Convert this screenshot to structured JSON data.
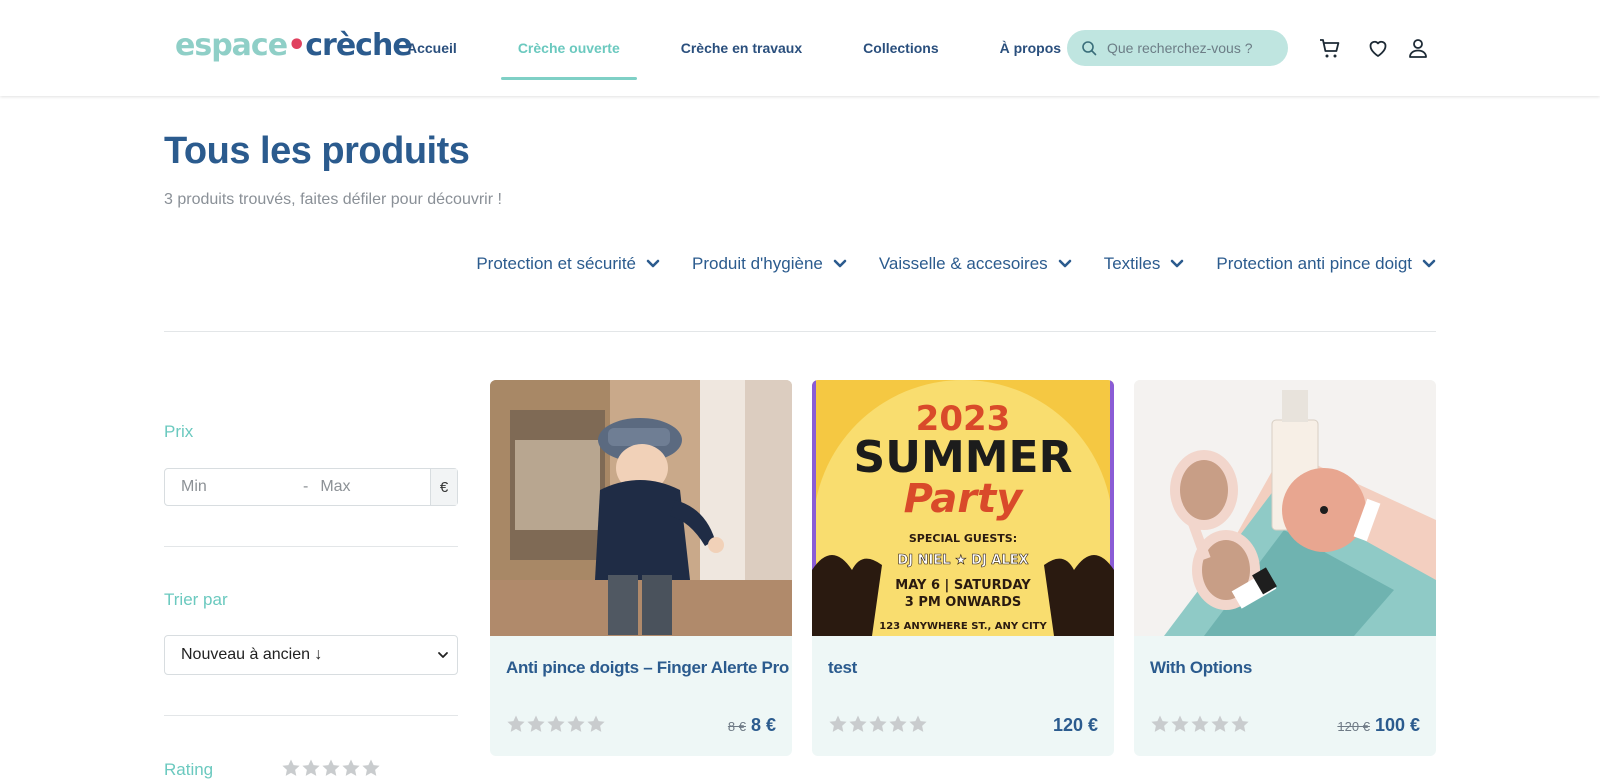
{
  "header": {
    "logo": {
      "part1": "espace",
      "dot": "•",
      "part2": "crèche"
    },
    "nav": [
      {
        "label": "Accueil",
        "active": false
      },
      {
        "label": "Crèche ouverte",
        "active": true
      },
      {
        "label": "Crèche en travaux",
        "active": false
      },
      {
        "label": "Collections",
        "active": false
      },
      {
        "label": "À propos",
        "active": false
      }
    ],
    "search_placeholder": "Que recherchez-vous ?",
    "icons": [
      "search-icon",
      "cart-icon",
      "heart-icon",
      "user-icon"
    ]
  },
  "page": {
    "title": "Tous les produits",
    "subtitle": "3 produits trouvés, faites défiler pour découvrir !"
  },
  "categories": [
    "Protection et sécurité",
    "Produit d'hygiène",
    "Vaisselle & accesoires",
    "Textiles",
    "Protection anti pince doigt"
  ],
  "sidebar": {
    "price_label": "Prix",
    "min_placeholder": "Min",
    "separator": "-",
    "max_placeholder": "Max",
    "currency": "€",
    "sort_label": "Trier par",
    "sort_value": "Nouveau à ancien ↓",
    "rating_label": "Rating"
  },
  "products": [
    {
      "name": "Anti pince doigts – Finger Alerte Pro",
      "old_price": "8 €",
      "price": "8 €",
      "rating": 0
    },
    {
      "name": "test",
      "old_price": "",
      "price": "120 €",
      "rating": 0
    },
    {
      "name": "With Options",
      "old_price": "120 €",
      "price": "100 €",
      "rating": 0
    }
  ],
  "poster": {
    "year": "2023",
    "line1": "SUMMER",
    "line2": "Party",
    "guests_label": "SPECIAL GUESTS:",
    "guests": "DJ NIEL ★ DJ ALEX",
    "date": "MAY 6 | SATURDAY",
    "time": "3 PM ONWARDS",
    "address": "123 ANYWHERE ST., ANY CITY"
  },
  "colors": {
    "brand_blue": "#2b5b8e",
    "accent_teal": "#6bc9bf",
    "card_bg": "#eef7f6",
    "search_bg": "#bfe5e0"
  }
}
